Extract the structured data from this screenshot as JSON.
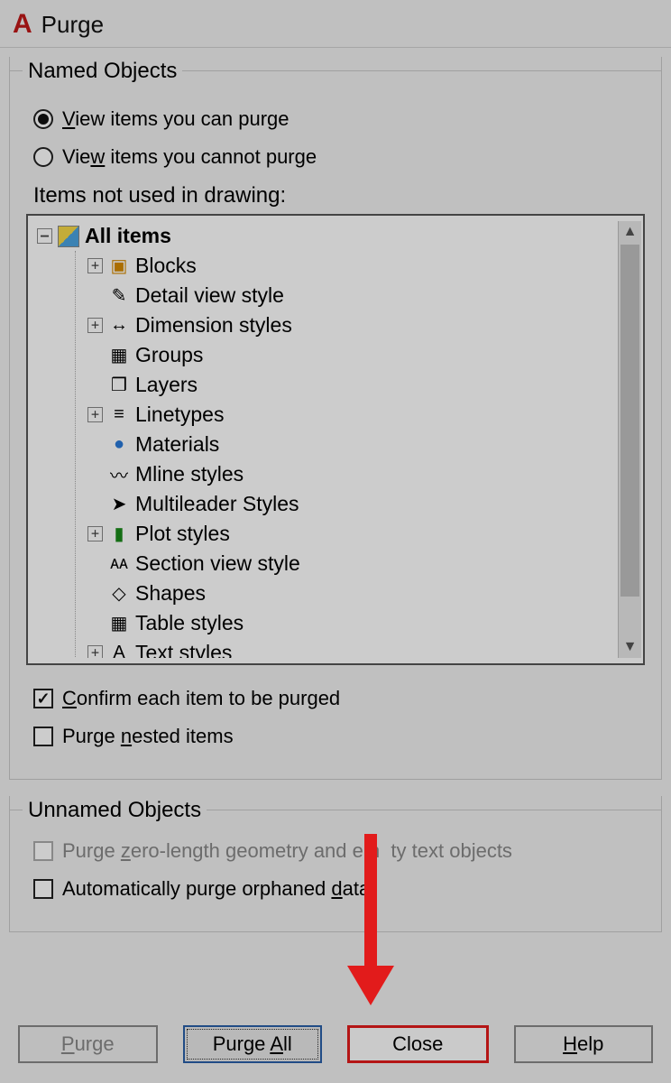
{
  "window": {
    "title": "Purge"
  },
  "named_group": {
    "legend": "Named Objects",
    "view_can_html": "<span class='mnemonic'>V</span>iew items you can purge",
    "view_cannot_html": "Vie<span class='mnemonic'>w</span> items you cannot purge",
    "items_label": "Items not used in drawing:",
    "confirm_html": "<span class='mnemonic'>C</span>onfirm each item to be purged",
    "nested_html": "Purge <span class='mnemonic'>n</span>ested items",
    "view_selected": "can"
  },
  "tree": {
    "root": "All items",
    "items": [
      {
        "label": "Blocks",
        "expand": "plus",
        "icon": "▣",
        "iconClass": "icon-blocks"
      },
      {
        "label": "Detail view style",
        "expand": "blank",
        "icon": "✎",
        "iconClass": ""
      },
      {
        "label": "Dimension styles",
        "expand": "plus",
        "icon": "↔",
        "iconClass": ""
      },
      {
        "label": "Groups",
        "expand": "blank",
        "icon": "▦",
        "iconClass": ""
      },
      {
        "label": "Layers",
        "expand": "blank",
        "icon": "❒",
        "iconClass": ""
      },
      {
        "label": "Linetypes",
        "expand": "plus",
        "icon": "≡",
        "iconClass": ""
      },
      {
        "label": "Materials",
        "expand": "blank",
        "icon": "●",
        "iconClass": "icon-materials"
      },
      {
        "label": "Mline styles",
        "expand": "blank",
        "icon": "〰",
        "iconClass": ""
      },
      {
        "label": "Multileader Styles",
        "expand": "blank",
        "icon": "➤",
        "iconClass": ""
      },
      {
        "label": "Plot styles",
        "expand": "plus",
        "icon": "▮",
        "iconClass": "icon-plot"
      },
      {
        "label": "Section view style",
        "expand": "blank",
        "icon": "ᴀᴀ",
        "iconClass": ""
      },
      {
        "label": "Shapes",
        "expand": "blank",
        "icon": "◇",
        "iconClass": ""
      },
      {
        "label": "Table styles",
        "expand": "blank",
        "icon": "▦",
        "iconClass": ""
      },
      {
        "label": "Text styles",
        "expand": "plus",
        "icon": "A",
        "iconClass": ""
      }
    ]
  },
  "unnamed_group": {
    "legend": "Unnamed Objects",
    "zero_len_html": "Purge <span class='mnemonic'>z</span>ero-length geometry and em&nbsp;&nbsp;ty text objects",
    "orphan_html": "Automatically purge orphaned <span class='mnemonic'>d</span>ata"
  },
  "buttons": {
    "purge_html": "<span class='mnemonic'>P</span>urge",
    "purge_all_html": "Purge <span class='mnemonic'>A</span>ll",
    "close": "Close",
    "help_html": "<span class='mnemonic'>H</span>elp"
  }
}
